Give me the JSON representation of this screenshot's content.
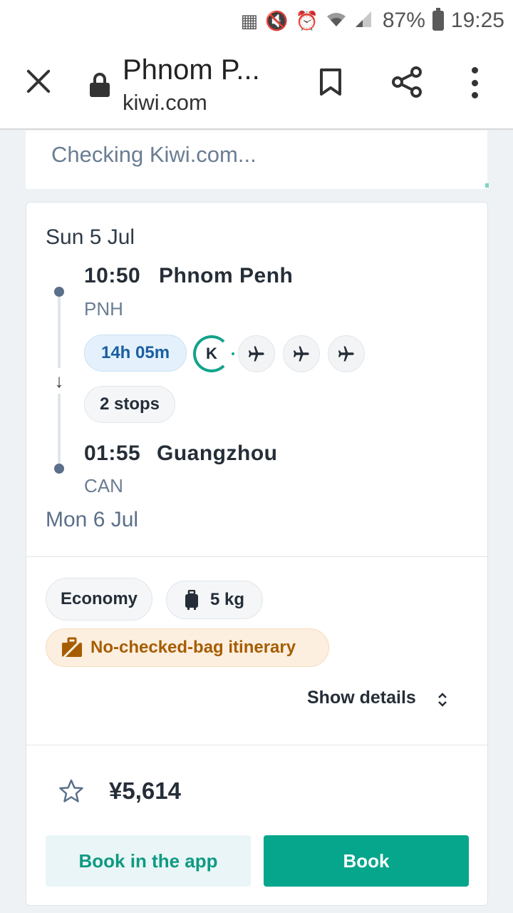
{
  "status_bar": {
    "battery": "87%",
    "time": "19:25",
    "icons": [
      "nfc-icon",
      "vibrate-icon",
      "alarm-icon",
      "wifi-icon",
      "signal-icon",
      "battery-icon"
    ]
  },
  "browser": {
    "title": "Phnom P...",
    "url": "kiwi.com"
  },
  "checking": {
    "text": "Checking Kiwi.com..."
  },
  "itinerary": {
    "departure_date": "Sun 5 Jul",
    "departure_time": "10:50",
    "departure_city": "Phnom Penh",
    "departure_code": "PNH",
    "duration": "14h 05m",
    "carrier_logo": "K",
    "stops": "2 stops",
    "arrival_time": "01:55",
    "arrival_city": "Guangzhou",
    "arrival_code": "CAN",
    "arrival_date": "Mon 6 Jul"
  },
  "fare": {
    "cabin_class": "Economy",
    "baggage": "5 kg",
    "no_checked_bag": "No-checked-bag itinerary",
    "show_details": "Show details"
  },
  "price": {
    "amount": "¥5,614"
  },
  "actions": {
    "book_in_app": "Book in the app",
    "book": "Book"
  },
  "colors": {
    "accent_teal": "#05a68c",
    "duration_blue": "#1a5fa0",
    "warning_orange": "#a65d00"
  }
}
